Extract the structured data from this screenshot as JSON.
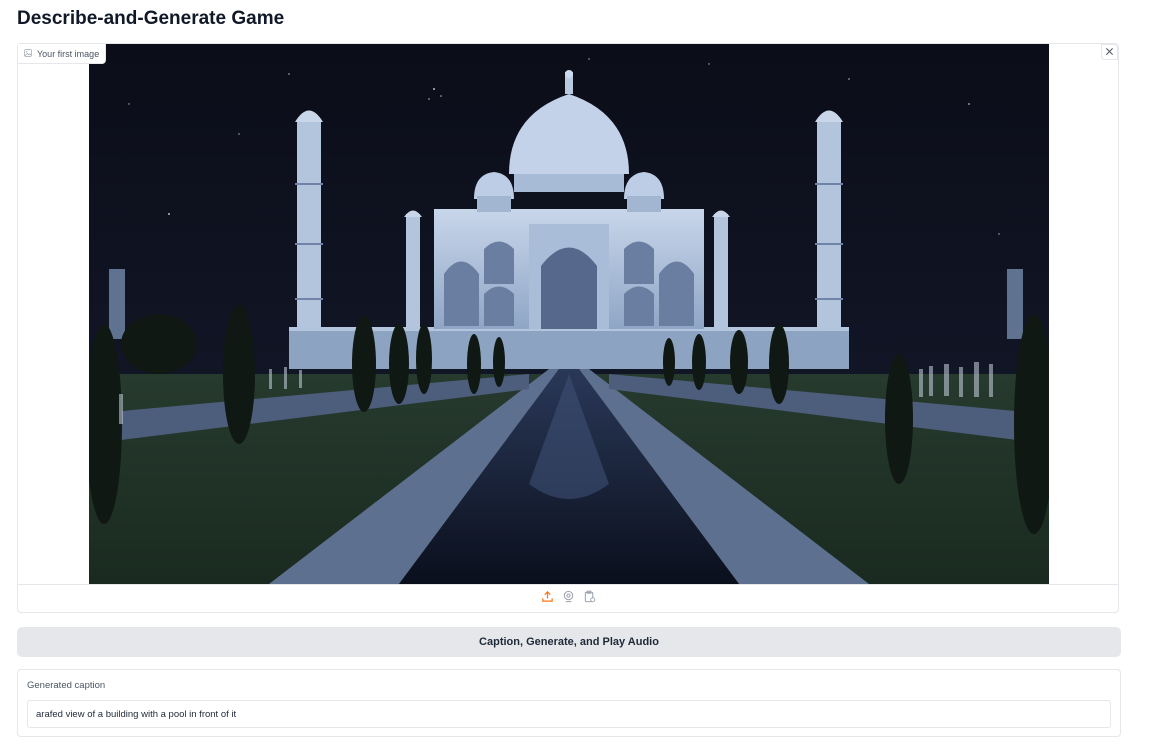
{
  "app": {
    "title": "Describe-and-Generate Game"
  },
  "image_input": {
    "label": "Your first image",
    "label_icon": "image-icon",
    "clear_icon": "close-icon",
    "image_subject": "Taj Mahal at night with reflecting pool",
    "sources": [
      {
        "name": "upload",
        "icon": "upload-icon",
        "color": "#f97316"
      },
      {
        "name": "webcam",
        "icon": "webcam-icon",
        "color": "#9ca3af"
      },
      {
        "name": "clipboard",
        "icon": "clipboard-icon",
        "color": "#9ca3af"
      }
    ]
  },
  "actions": {
    "run_label": "Caption, Generate, and Play Audio"
  },
  "caption": {
    "label": "Generated caption",
    "value": "arafed view of a building with a pool in front of it"
  },
  "colors": {
    "accent": "#f97316",
    "button_bg": "#e5e7eb",
    "border": "#e5e7eb"
  }
}
